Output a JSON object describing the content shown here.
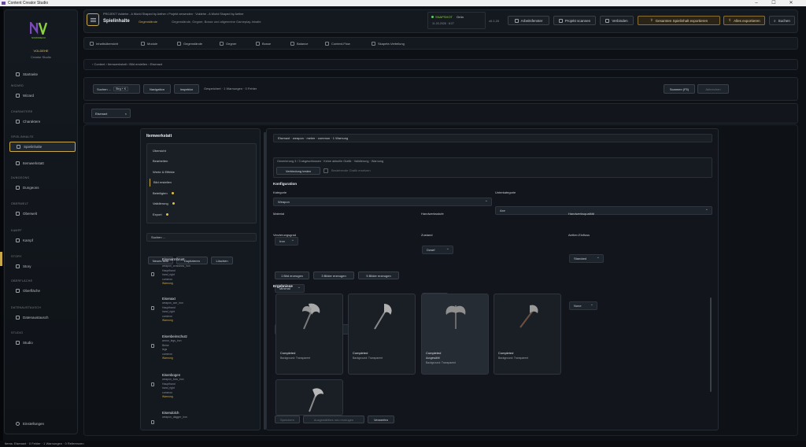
{
  "window": {
    "title": "Content Creator Studio",
    "controls": [
      "–",
      "☐",
      "✕"
    ]
  },
  "brand": {
    "logo_text": "NV",
    "logo_sub": "NOMORECO",
    "title": "VOLDEHE",
    "subtitle": "Creator Studio"
  },
  "sidebar": {
    "items": [
      {
        "section": "",
        "label": "Startseite",
        "icon": "home-icon"
      },
      {
        "section": "WIZARD",
        "label": "Wizard",
        "icon": "wand-icon"
      },
      {
        "section": "CHARAKTERE",
        "label": "Charaktere",
        "icon": "user-icon"
      },
      {
        "section": "SPIELINHALTE",
        "label": "Spielinhalte",
        "icon": "grid-icon",
        "active": true
      },
      {
        "section": "",
        "label": "Itemwerkstatt",
        "icon": "hammer-icon"
      },
      {
        "section": "DUNGEONS",
        "label": "Dungeons",
        "icon": "castle-icon"
      },
      {
        "section": "OBERWELT",
        "label": "Oberwelt",
        "icon": "globe-icon"
      },
      {
        "section": "KAMPF",
        "label": "Kampf",
        "icon": "sword-icon"
      },
      {
        "section": "STORY",
        "label": "Story",
        "icon": "book-icon"
      },
      {
        "section": "OBERFLÄCHE",
        "label": "Oberfläche",
        "icon": "layout-icon"
      },
      {
        "section": "DATENAUSTAUSCH",
        "label": "Datenaustausch",
        "icon": "exchange-icon"
      },
      {
        "section": "STUDIO",
        "label": "Studio",
        "icon": "studio-icon"
      }
    ],
    "settings_label": "Einstellungen"
  },
  "topbar": {
    "project_line": "PROJEKT  Voldehe - A World Shaped by Aether   •  Projekt versenden · Voldehe - A World Shaped by Aether",
    "page_title": "Spielinhalte",
    "page_sub": "Gegenstände",
    "page_desc": "Gegenstände, Gegner, Bosse und allgemeine Gameplay-Inhalte",
    "snapshot_label": "SNAPSHOT",
    "snapshot_status": "Grün",
    "snapshot_date": "11.03.2026 · 8:27",
    "version": "v0.1.20",
    "buttons": [
      "Arbeitsfenster",
      "Projekt scannen",
      "Verbinden",
      "Gesamten Spielinhalt exportieren",
      "Alles exportieren",
      "Suchen"
    ]
  },
  "tabs": [
    "Inhaltsübersicht",
    "Module",
    "Gegenstände",
    "Gegner",
    "Bosse",
    "Balance",
    "Content-Flow",
    "Skapete-Verteilung"
  ],
  "breadcrumb": "‹ Content › Itemwerkstatt › Bild erstellen › Eisenaxt",
  "toolbar": {
    "search_label": "Suchen ...",
    "shortcut": "Strg + K",
    "nav_label": "Navigation",
    "inspector_label": "Inspektor",
    "status": "Gespeichert · 1 Warnungen · 0 Fehler",
    "scan_label": "Scannen (F5)",
    "cancel_label": "Abbrechen"
  },
  "chip": {
    "label": "Eisenaxt",
    "close": "×"
  },
  "itemwerkstatt": {
    "title": "Itemwerkstatt",
    "steps": [
      {
        "label": "Übersicht"
      },
      {
        "label": "Bearbeiten"
      },
      {
        "label": "Werte & Effekte"
      },
      {
        "label": "Bild erstellen",
        "current": true
      },
      {
        "label": "Beteiligten",
        "dot": true
      },
      {
        "label": "Validierung",
        "dot": true
      },
      {
        "label": "Export",
        "dot": true
      }
    ],
    "search_placeholder": "Suchen ...",
    "list_buttons": [
      "Neues Item",
      "Duplizieren",
      "Löschen"
    ],
    "list_header": "Eisenarmbrust",
    "list": [
      {
        "title": "",
        "lines": [
          "weapon_crossbow_iron",
          "Haupthand",
          "hand_right",
          "common"
        ],
        "warn": "Warnung"
      },
      {
        "title": "Eisenaxt",
        "lines": [
          "weapon_axe_iron",
          "Haupthand",
          "hand_right",
          "common"
        ],
        "warn": "Warnung"
      },
      {
        "title": "Eisenbeinschutz",
        "lines": [
          "armor_legs_iron",
          "Beine",
          "legs",
          "common"
        ],
        "warn": "Warnung"
      },
      {
        "title": "Eisenbogen",
        "lines": [
          "weapon_bow_iron",
          "Haupthand",
          "hand_right",
          "common"
        ],
        "warn": "Warnung"
      },
      {
        "title": "Eisendolch",
        "lines": [
          "weapon_dagger_iron"
        ],
        "warn": ""
      }
    ]
  },
  "editor": {
    "header": "Eisenaxt · weapon · melee · common · 1 Warnung",
    "gen_info": "Generierung 3 / 3 abgeschlossen · Keine aktuelle Grafik · Validierung · Warnung",
    "connect_btn": "Verbindung testen",
    "checkbox_label": "Bestehende Grafik ersetzen",
    "config_title": "Konfiguration",
    "kategorie_label": "Kategorie",
    "kategorie_value": "Weapon",
    "unterkategorie_label": "Unterkategorie",
    "unterkategorie_value": "Axe",
    "material_label": "Material",
    "material_value": "Iron",
    "handwerk_label": "Handwerksstufe",
    "handwerk_value": "Dwarf",
    "qualitaet_label": "Handwerksqualität",
    "qualitaet_value": "Standard",
    "verzierung_label": "Verzierungsgrad",
    "verzierung_value": "Minimal",
    "zustand_label": "Zustand",
    "zustand_value": "Used",
    "aether_label": "Aether-Einfluss",
    "aether_value": "None",
    "prompt_btn": "Prompt anzeigen / bearbeiten",
    "gen_buttons": [
      "1 Bild erzeugen",
      "3 Bilder erzeugen",
      "5 Bilder erzeugen"
    ],
    "results_title": "Ergebnisse",
    "results": [
      {
        "status": "Completed",
        "extra": "",
        "desc": "Background: Transparent"
      },
      {
        "status": "Completed",
        "extra": "",
        "desc": "Background: Transparent"
      },
      {
        "status": "Completed",
        "extra": "Ausgewählt",
        "desc": "Background: Transparent",
        "selected": true
      },
      {
        "status": "Completed",
        "extra": "",
        "desc": "Background: Transparent"
      }
    ],
    "footer_buttons": [
      "Speichern",
      "Ausgewähltes neu erzeugen",
      "Verwerfen"
    ]
  },
  "statusbar": "Items: Eisenaxt · 0 Fehler · 1 Warnungen · 0 Referenzen",
  "colors": {
    "accent_gold": "#c8a848",
    "warning": "#d0a838",
    "logo_green": "#8ad33a",
    "logo_purple": "#7a4ab8"
  }
}
